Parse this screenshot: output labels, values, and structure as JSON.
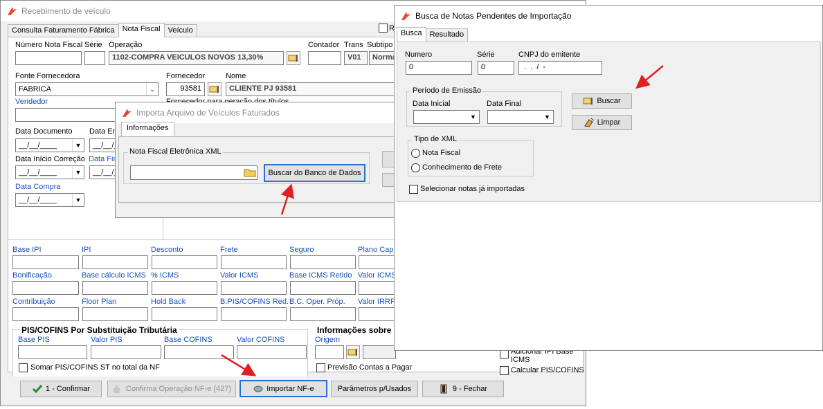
{
  "main": {
    "title": "Recebimento de veículo",
    "tabs": [
      "Consulta Faturamento Fábrica",
      "Nota Fiscal",
      "Veículo"
    ],
    "hdr_check_label": "R",
    "fields": {
      "numero_nf": "Número Nota Fiscal",
      "serie": "Série",
      "operacao": "Operação",
      "operacao_value": "1102-COMPRA VEICULOS NOVOS 13,30%",
      "contador": "Contador",
      "trans": "Trans",
      "trans_value": "V01",
      "subtipo": "Subtipo",
      "subtipo_value": "Norma",
      "fonte": "Fonte Fornecedora",
      "fonte_value": "FABRICA",
      "fornecedor": "Fornecedor",
      "fornecedor_value": "93581",
      "nome": "Nome",
      "nome_value": "CLIENTE PJ 93581",
      "forn_titulos": "Fornecedor para geração dos títulos",
      "vendedor": "Vendedor",
      "data_documento": "Data Documento",
      "data_entrada": "Data Ent",
      "data_inicio": "Data Início Correção",
      "data_fim": "Data Fim",
      "data_compra": "Data Compra",
      "date_mask": "__/__/____"
    },
    "grid_rows": [
      [
        "Base IPI",
        "IPI",
        "Desconto",
        "Frete",
        "Seguro",
        "Plano Capit"
      ],
      [
        "Bonificação",
        "Base cálculo ICMS",
        "% ICMS",
        "Valor ICMS",
        "Base ICMS Retido",
        "Valor ICMS"
      ],
      [
        "Contribuição",
        "Floor Plan",
        "Hold Back",
        "B.PIS/COFINS Red.",
        "B.C. Oper. Próp.",
        "Valor IRRF"
      ]
    ],
    "pis": {
      "title": "PIS/COFINS Por Substituição Tributária",
      "labels": [
        "Base PIS",
        "Valor PIS",
        "Base COFINS",
        "Valor COFINS"
      ],
      "somar": "Somar PIS/COFINS ST no total da NF"
    },
    "info": {
      "title": "Informações sobre C",
      "origem": "Origem",
      "previsao": "Previsão Contas a Pagar"
    },
    "right_checks": [
      "Adicionar IPI Base ICMS",
      "Calcular PIS/COFINS"
    ],
    "footer": {
      "confirmar": "1 - Confirmar",
      "confirma_op": "Confirma Operação NF-e  (427)",
      "importar": "Importar  NF-e",
      "parametros": "Parâmetros p/Usados",
      "fechar": "9 - Fechar"
    }
  },
  "importa": {
    "title": "Importa Arquivo de Veículos Faturados",
    "tab": "Informações",
    "group": "Nota Fiscal Eletrônica XML",
    "buscar_banco": "Buscar do Banco de Dados"
  },
  "busca": {
    "title": "Busca de Notas Pendentes de Importação",
    "tabs": [
      "Busca",
      "Resultado"
    ],
    "numero_label": "Numero",
    "numero_value": "0",
    "serie_label": "Série",
    "serie_value": "0",
    "cnpj_label": "CNPJ do emitente",
    "cnpj_value": " .  .  /  -",
    "periodo": "Período de Emissão",
    "data_inicial": "Data Inicial",
    "data_final": "Data Final",
    "buscar": "Buscar",
    "limpar": "Limpar",
    "tipo_xml": "Tipo de XML",
    "nota_fiscal": "Nota Fiscal",
    "conhecimento": "Conhecimento de Frete",
    "selecionar": "Selecionar notas já importadas"
  },
  "colors": {
    "accent": "#2b6cd1",
    "arrow": "#e02020",
    "label_blue": "#1a4fb8"
  }
}
